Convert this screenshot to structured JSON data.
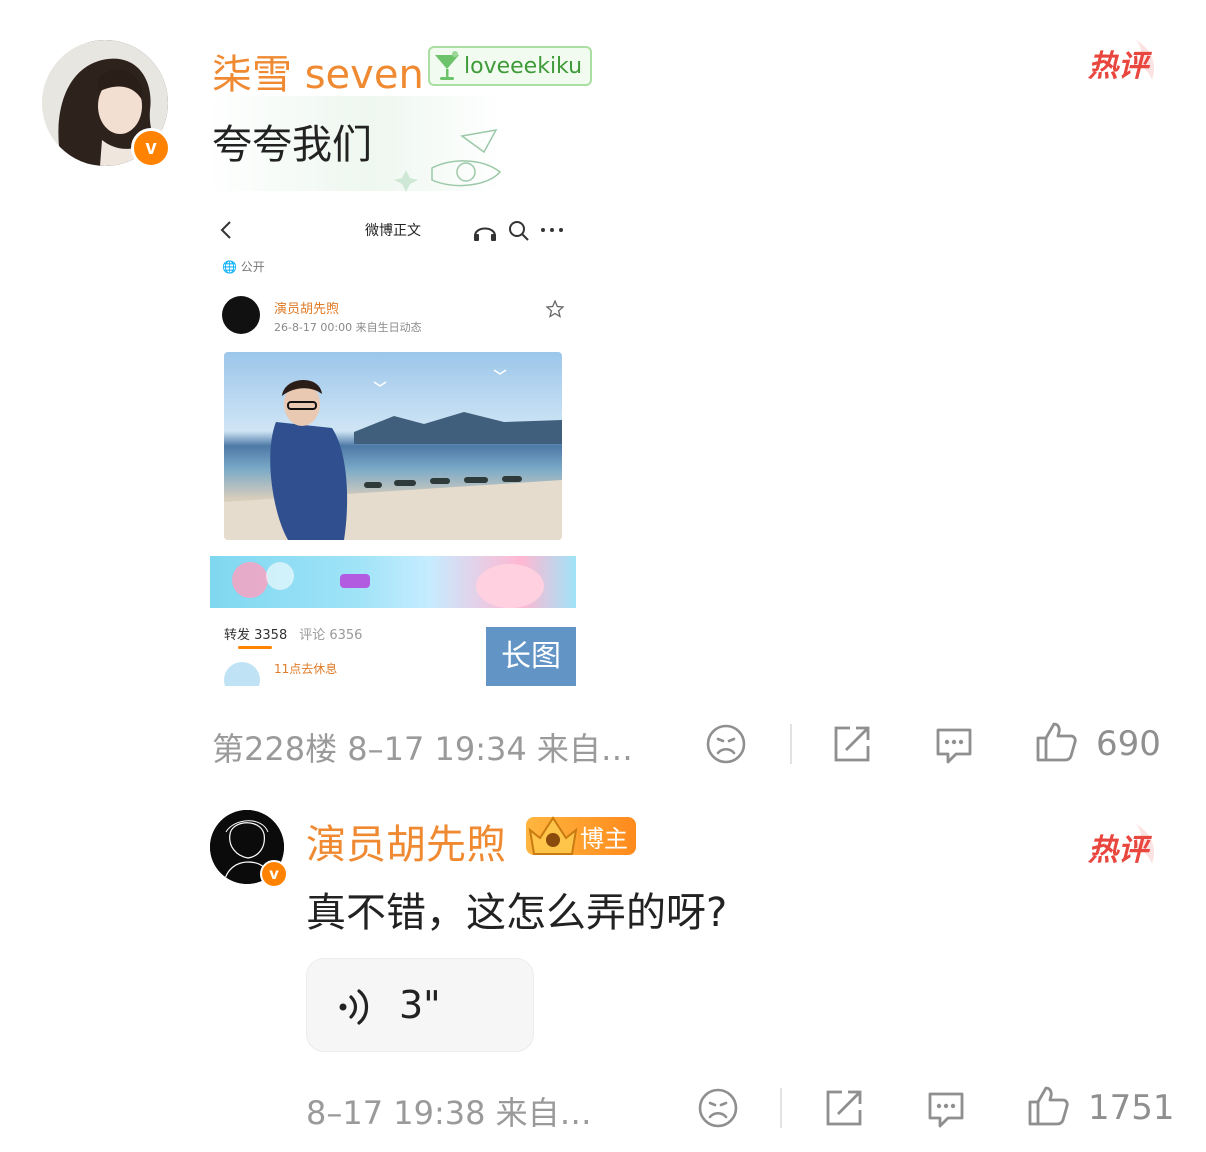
{
  "colors": {
    "accent_orange": "#ff8200",
    "username": "#f08a32",
    "hot_red": "#e8463f",
    "meta_gray": "#9a9a9a"
  },
  "comment1": {
    "username": "柒雪 seven",
    "fan_badge": "loveeekiku",
    "text": "夸夸我们",
    "hot_badge": "热评",
    "embedded": {
      "nav_title": "微博正文",
      "visibility": "公开",
      "author": "演员胡先煦",
      "time_source": "26-8-17 00:00  来自生日动态",
      "repost_tab": "转发 3358",
      "comment_tab": "评论 6356",
      "sub_author": "11点去休息",
      "long_image_label": "长图"
    },
    "meta": "第228楼 8–17 19:34 来自…",
    "likes": "690",
    "icons": [
      "dislike-icon",
      "share-icon",
      "comment-icon",
      "like-icon"
    ]
  },
  "comment2": {
    "username": "演员胡先煦",
    "role_badge": "博主",
    "text": "真不错，这怎么弄的呀?",
    "hot_badge": "热评",
    "voice_length": "3\"",
    "meta": "8–17 19:38 来自…",
    "likes": "1751"
  }
}
